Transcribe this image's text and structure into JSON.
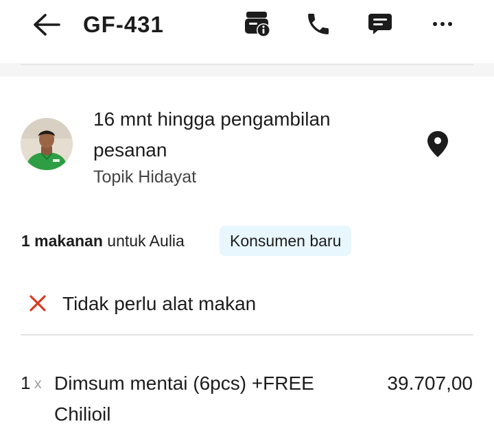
{
  "header": {
    "title": "GF-431",
    "icons": [
      "back-arrow-icon",
      "order-info-icon",
      "phone-icon",
      "chat-icon",
      "more-icon"
    ]
  },
  "driver": {
    "eta_text": "16 mnt hingga pengambilan pesanan",
    "name": "Topik Hidayat",
    "avatar_accent": "#2e9e45"
  },
  "order": {
    "count_label": "1 makanan",
    "for_label": "untuk Aulia",
    "badge": "Konsumen baru",
    "cutlery_note": "Tidak perlu alat makan",
    "items": [
      {
        "qty": "1",
        "qty_suffix": "x",
        "name": "Dimsum mentai (6pcs) +FREE Chilioil",
        "price": "39.707,00"
      }
    ]
  },
  "colors": {
    "text": "#1c1c1c",
    "badge_bg": "#e8f6fd",
    "cross_icon": "#d9391f",
    "divider": "#e3e3e3"
  }
}
